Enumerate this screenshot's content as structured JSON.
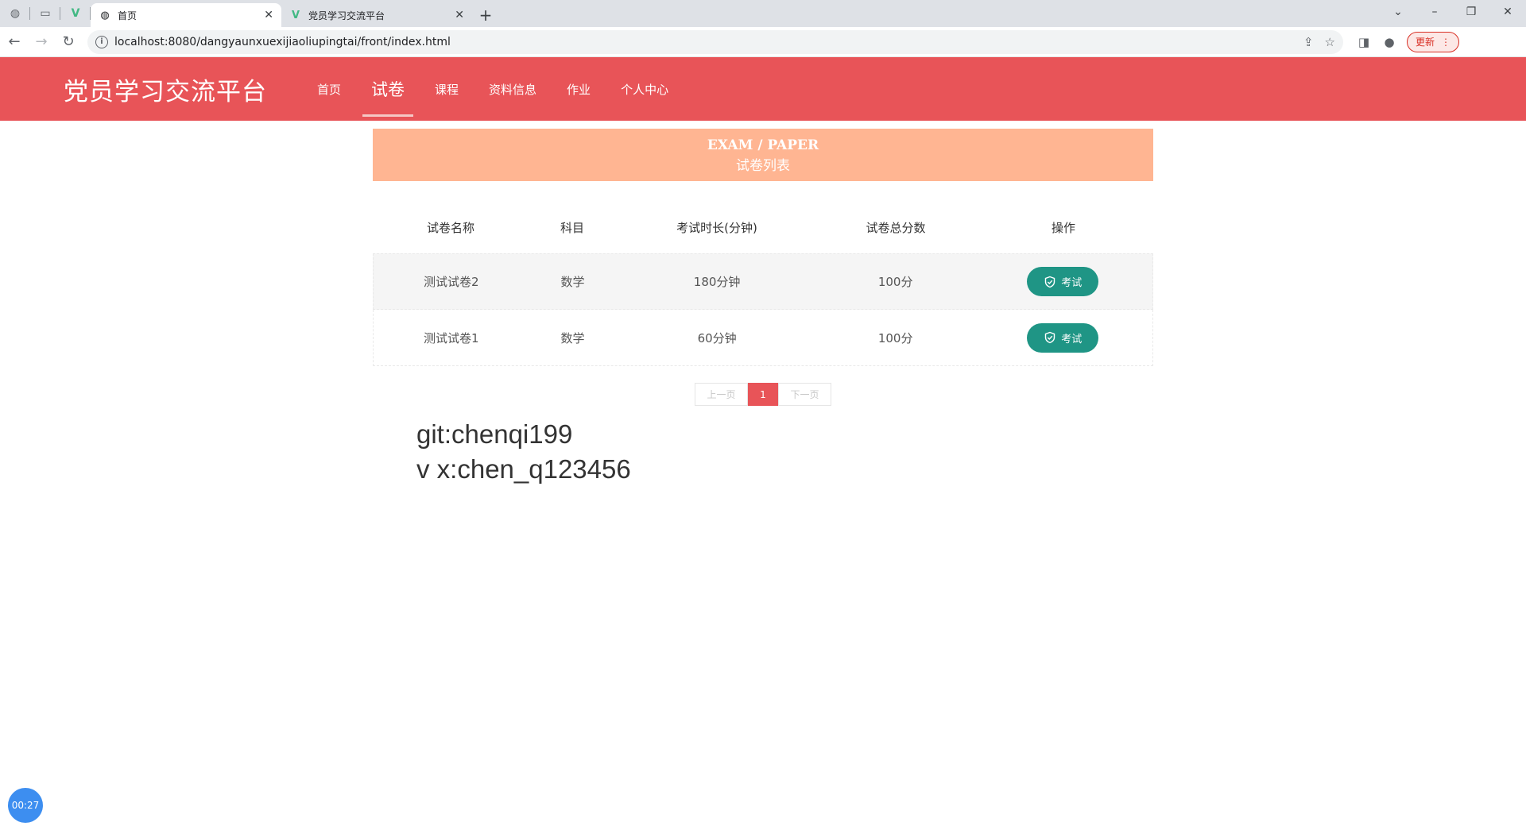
{
  "browser": {
    "tabs": [
      {
        "title": "首页",
        "active": true
      },
      {
        "title": "党员学习交流平台",
        "active": false
      }
    ],
    "url": "localhost:8080/dangyaunxuexijiaoliupingtai/front/index.html",
    "update_label": "更新"
  },
  "app": {
    "brand": "党员学习交流平台",
    "nav": [
      "首页",
      "试卷",
      "课程",
      "资料信息",
      "作业",
      "个人中心"
    ],
    "active_nav": "试卷"
  },
  "banner": {
    "title_en": "EXAM / PAPER",
    "title_cn": "试卷列表"
  },
  "table": {
    "headers": [
      "试卷名称",
      "科目",
      "考试时长(分钟)",
      "试卷总分数",
      "操作"
    ],
    "rows": [
      {
        "name": "测试试卷2",
        "subject": "数学",
        "duration": "180分钟",
        "score": "100分",
        "action": "考试"
      },
      {
        "name": "测试试卷1",
        "subject": "数学",
        "duration": "60分钟",
        "score": "100分",
        "action": "考试"
      }
    ]
  },
  "pagination": {
    "prev": "上一页",
    "current": "1",
    "next": "下一页"
  },
  "notes": [
    "git:chenqi199",
    "v x:chen_q123456"
  ],
  "timer": "00:27",
  "colors": {
    "header": "#e85458",
    "banner": "#ffb592",
    "button": "#1f9585"
  }
}
